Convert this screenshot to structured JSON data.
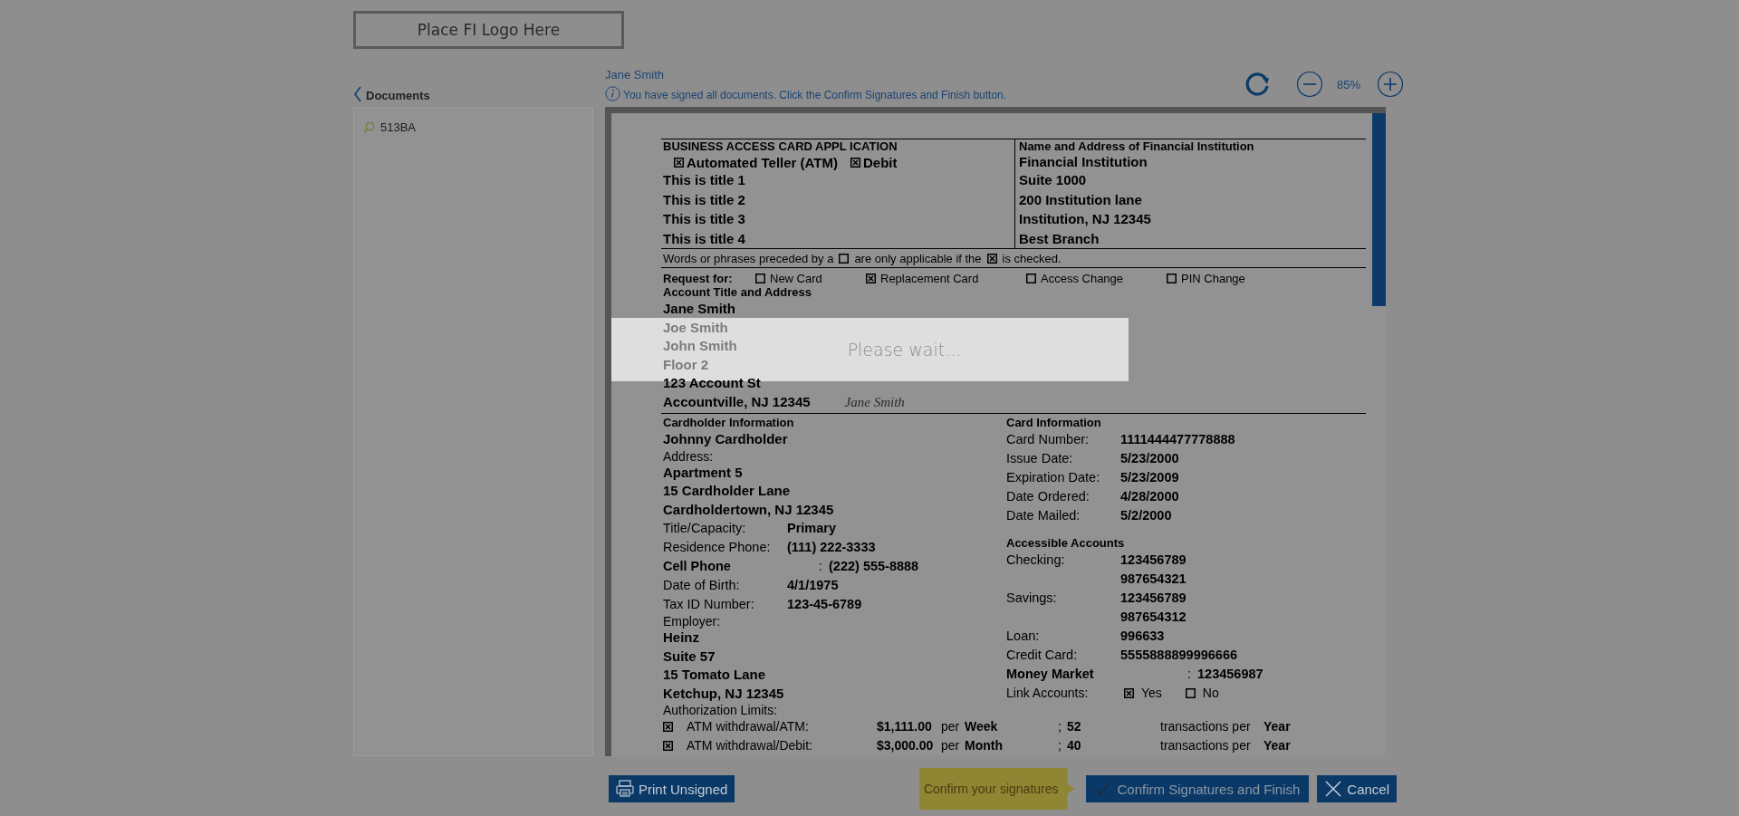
{
  "logo": {
    "text": "Place FI Logo Here"
  },
  "sidebar": {
    "back_label": "Documents",
    "items": [
      {
        "label": "513BA",
        "selected": false
      }
    ]
  },
  "viewer": {
    "signer": "Jane Smith",
    "info": "You have signed all documents. Click the Confirm Signatures and Finish button.",
    "zoom": "85%"
  },
  "document": {
    "title": "BUSINESS ACCESS CARD APPL ICATION",
    "card_types": [
      {
        "label": "Automated Teller (ATM)",
        "checked": true
      },
      {
        "label": "Debit",
        "checked": true
      }
    ],
    "titles": [
      "This is title 1",
      "This is title 2",
      "This is title 3",
      "This is title 4"
    ],
    "institution_heading": "Name and Address of Financial Institution",
    "institution_lines": [
      "Financial Institution",
      "Suite 1000",
      "200 Institution lane",
      "Institution, NJ 12345",
      "Best Branch"
    ],
    "note": [
      {
        "kind": "text",
        "text": "Words or phrases preceded by a"
      },
      {
        "kind": "box",
        "checked": false
      },
      {
        "kind": "text",
        "text": "are only applicable if the"
      },
      {
        "kind": "box",
        "checked": true
      },
      {
        "kind": "text",
        "text": "is checked."
      }
    ],
    "request_label": "Request for:",
    "request_options": [
      {
        "label": "New Card",
        "checked": false
      },
      {
        "label": "Replacement Card",
        "checked": true
      },
      {
        "label": "Access Change",
        "checked": false
      },
      {
        "label": "PIN Change",
        "checked": false
      }
    ],
    "account_heading": "Account Title and Address",
    "account_lines": [
      {
        "text": "Jane Smith",
        "covered": false
      },
      {
        "text": "Joe Smith",
        "covered": true
      },
      {
        "text": "John Smith",
        "covered": true
      },
      {
        "text": "Floor 2",
        "covered": true
      },
      {
        "text": "123 Account St",
        "covered": false
      },
      {
        "text": "Accountville, NJ 12345",
        "covered": false
      }
    ],
    "signature": "Jane Smith",
    "cardholder_heading": "Cardholder Information",
    "cardholder_rows": [
      {
        "kind": "value",
        "text": "Johnny Cardholder"
      },
      {
        "kind": "label",
        "text": "Address:"
      },
      {
        "kind": "value",
        "text": "Apartment 5"
      },
      {
        "kind": "value",
        "text": "15 Cardholder Lane"
      },
      {
        "kind": "value",
        "text": "Cardholdertown, NJ 12345"
      },
      {
        "kind": "pair",
        "label": "Title/Capacity:",
        "value": "Primary"
      },
      {
        "kind": "pair",
        "label": "Residence Phone:",
        "value": "(111) 222-3333"
      },
      {
        "kind": "bold_pair",
        "label": "Cell Phone",
        "sep": ":",
        "value": "(222) 555-8888"
      },
      {
        "kind": "pair",
        "label": "Date of Birth:",
        "value": "4/1/1975"
      },
      {
        "kind": "pair",
        "label": "Tax ID Number:",
        "value": "123-45-6789"
      },
      {
        "kind": "label",
        "text": "Employer:"
      },
      {
        "kind": "value",
        "text": "Heinz"
      },
      {
        "kind": "value",
        "text": "Suite 57"
      },
      {
        "kind": "value",
        "text": "15 Tomato Lane"
      },
      {
        "kind": "value",
        "text": "Ketchup, NJ 12345"
      },
      {
        "kind": "label",
        "text": "Authorization Limits:"
      }
    ],
    "card_heading": "Card Information",
    "card_rows": [
      {
        "kind": "pair",
        "label": "Card Number:",
        "value": "1111444477778888"
      },
      {
        "kind": "pair",
        "label": "Issue Date:",
        "value": "5/23/2000"
      },
      {
        "kind": "pair",
        "label": "Expiration Date:",
        "value": "5/23/2009"
      },
      {
        "kind": "pair",
        "label": "Date Ordered:",
        "value": "4/28/2000"
      },
      {
        "kind": "pair",
        "label": "Date Mailed:",
        "value": "5/2/2000"
      },
      {
        "kind": "heading",
        "text": "Accessible Accounts"
      },
      {
        "kind": "pair",
        "label": "Checking:",
        "value": "123456789"
      },
      {
        "kind": "pair",
        "value": "987654321"
      },
      {
        "kind": "pair",
        "label": "Savings:",
        "value": "123456789"
      },
      {
        "kind": "pair",
        "value": "987654312"
      },
      {
        "kind": "pair",
        "label": "Loan:",
        "value": "996633"
      },
      {
        "kind": "pair",
        "label": "Credit Card:",
        "value": "5555888899996666"
      },
      {
        "kind": "bold_pair",
        "label": "Money Market",
        "sep": ":",
        "value": "123456987"
      },
      {
        "kind": "choice",
        "label": "Link Accounts:",
        "options": [
          {
            "label": "Yes",
            "checked": true
          },
          {
            "label": "No",
            "checked": false
          }
        ]
      }
    ],
    "limits": [
      {
        "checked": true,
        "label": "ATM withdrawal/ATM:",
        "amount": "$1,111.00",
        "per": "per",
        "period": "Week",
        "sep": ";",
        "count": "52",
        "tx": "transactions per",
        "tx_period": "Year"
      },
      {
        "checked": true,
        "label": "ATM withdrawal/Debit:",
        "amount": "$3,000.00",
        "per": "per",
        "period": "Month",
        "sep": ";",
        "count": "40",
        "tx": "transactions per",
        "tx_period": "Year"
      }
    ]
  },
  "loading": {
    "text": "Please wait..."
  },
  "footer": {
    "tooltip": "Confirm your signatures",
    "buttons": [
      {
        "kind": "print",
        "label": "Print Unsigned"
      },
      {
        "kind": "confirm",
        "label": "Confirm Signatures and Finish"
      },
      {
        "kind": "cancel",
        "label": "Cancel"
      }
    ]
  }
}
